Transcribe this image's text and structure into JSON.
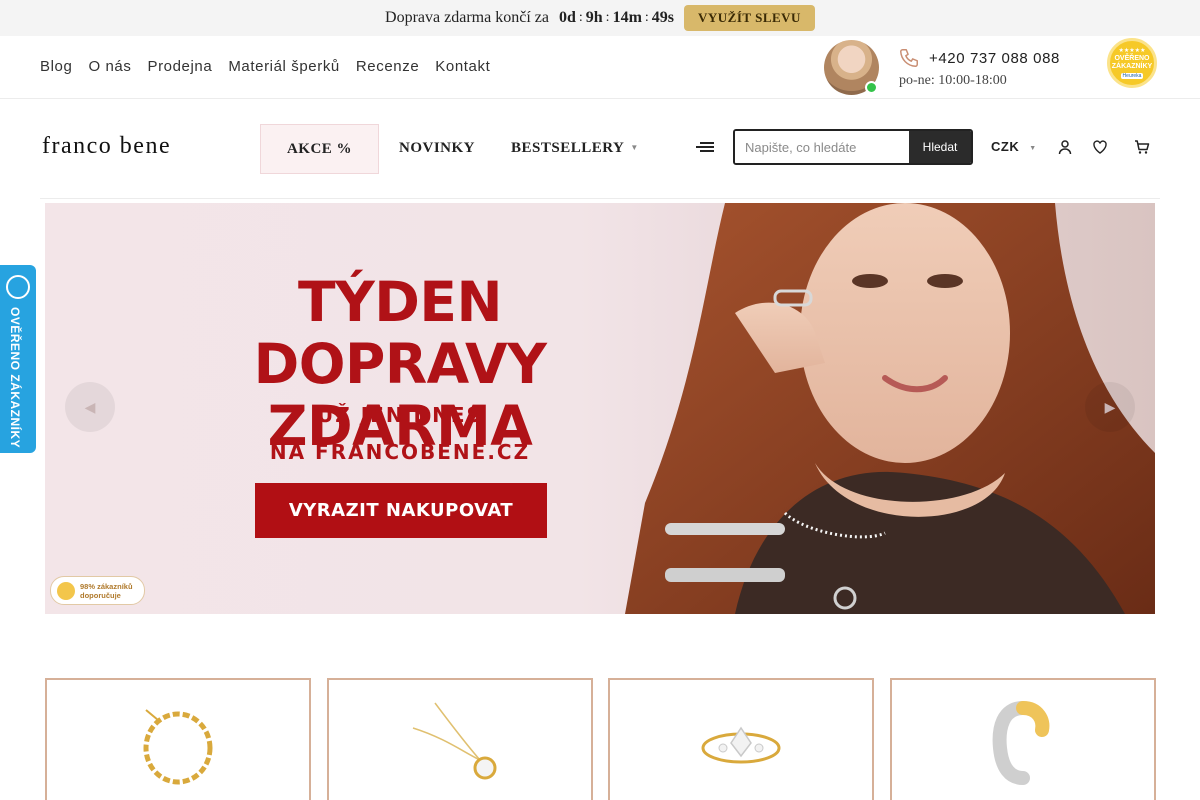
{
  "announcement": {
    "text": "Doprava zdarma končí za",
    "countdown": {
      "days": "0d",
      "hours": "9h",
      "minutes": "14m",
      "seconds": "49s",
      "separator": ":"
    },
    "button_label": "VYUŽÍT SLEVU"
  },
  "top_links": [
    "Blog",
    "O nás",
    "Prodejna",
    "Materiál šperků",
    "Recenze",
    "Kontakt"
  ],
  "contact": {
    "phone": "+420 737 088 088",
    "hours": "po-ne: 10:00-18:00"
  },
  "verified_badge": {
    "text": "OVĚŘENO ZÁKAZNÍKY",
    "brand": "Heureka"
  },
  "logo": "franco bene",
  "nav": {
    "akce": "AKCE %",
    "novinky": "NOVINKY",
    "bestsellery": "BESTSELLERY"
  },
  "search": {
    "placeholder": "Napište, co hledáte",
    "button_label": "Hledat"
  },
  "currency": "CZK",
  "icons": {
    "menu": "hamburger-menu-icon",
    "account": "user-icon",
    "wishlist": "heart-icon",
    "cart": "cart-icon",
    "phone": "phone-icon",
    "prev": "chevron-left-icon",
    "next": "chevron-right-icon"
  },
  "hero": {
    "title_line1": "TÝDEN DOPRAVY",
    "title_line2": "ZDARMA",
    "subtitle1": "UŽ JEN DNES",
    "subtitle2": "NA FRANCOBENE.CZ",
    "cta_label": "VYRAZIT NAKUPOVAT",
    "recommend_line1": "98% zákazníků",
    "recommend_line2": "doporučuje"
  },
  "side_tab": {
    "text": "OVĚŘENO ZÁKAZNÍKY"
  },
  "colors": {
    "brand_red": "#b01217",
    "gold_button": "#d8b86a",
    "card_border": "#d6b098",
    "side_tab_blue": "#27a3e0"
  },
  "products": [
    {
      "icon": "gold-chain-bracelet-icon"
    },
    {
      "icon": "crystal-pendant-necklace-icon"
    },
    {
      "icon": "crystal-ring-icon"
    },
    {
      "icon": "two-tone-earring-icon"
    }
  ]
}
